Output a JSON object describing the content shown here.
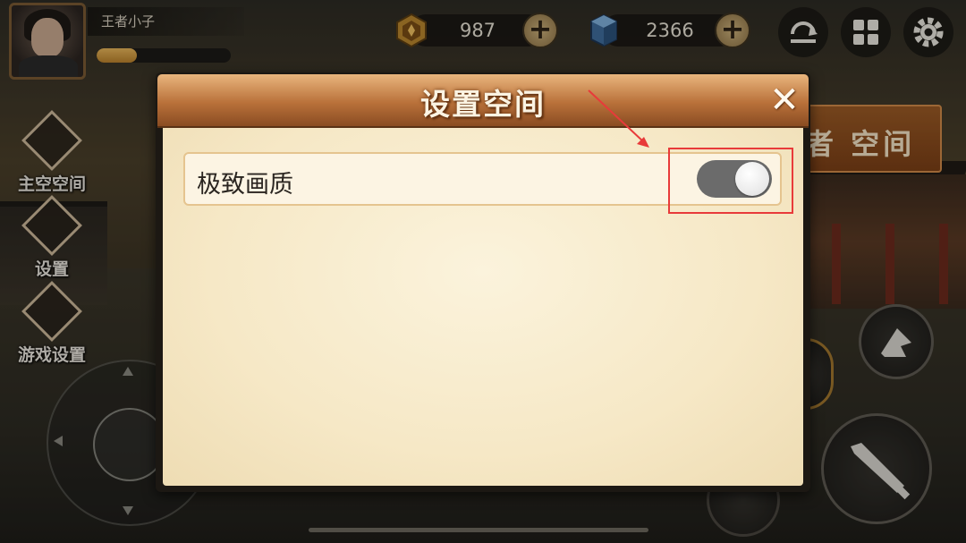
{
  "player": {
    "name": "王者小子",
    "exp_fraction": 0.3
  },
  "currencies": [
    {
      "icon": "gold-emblem-icon",
      "value": "987",
      "plus": "+"
    },
    {
      "icon": "blue-gem-icon",
      "value": "2366",
      "plus": "+"
    }
  ],
  "top_icons": [
    "refresh-icon",
    "menu-grid-icon",
    "gear-icon"
  ],
  "side_menu": [
    {
      "label": "主空空间",
      "icon": "emblem-icon"
    },
    {
      "label": "设置",
      "icon": "bag-icon"
    },
    {
      "label": "游戏设置",
      "icon": "flower-icon"
    }
  ],
  "background_button": {
    "label": "者 空间"
  },
  "dialog": {
    "title": "设置空间",
    "close_symbol": "✕",
    "settings": [
      {
        "label": "极致画质",
        "enabled": true
      }
    ]
  },
  "colors": {
    "header": "#c07a40",
    "body": "#f6e8c6",
    "toggle_track": "#6b6b6b",
    "highlight": "#e83a3a"
  }
}
